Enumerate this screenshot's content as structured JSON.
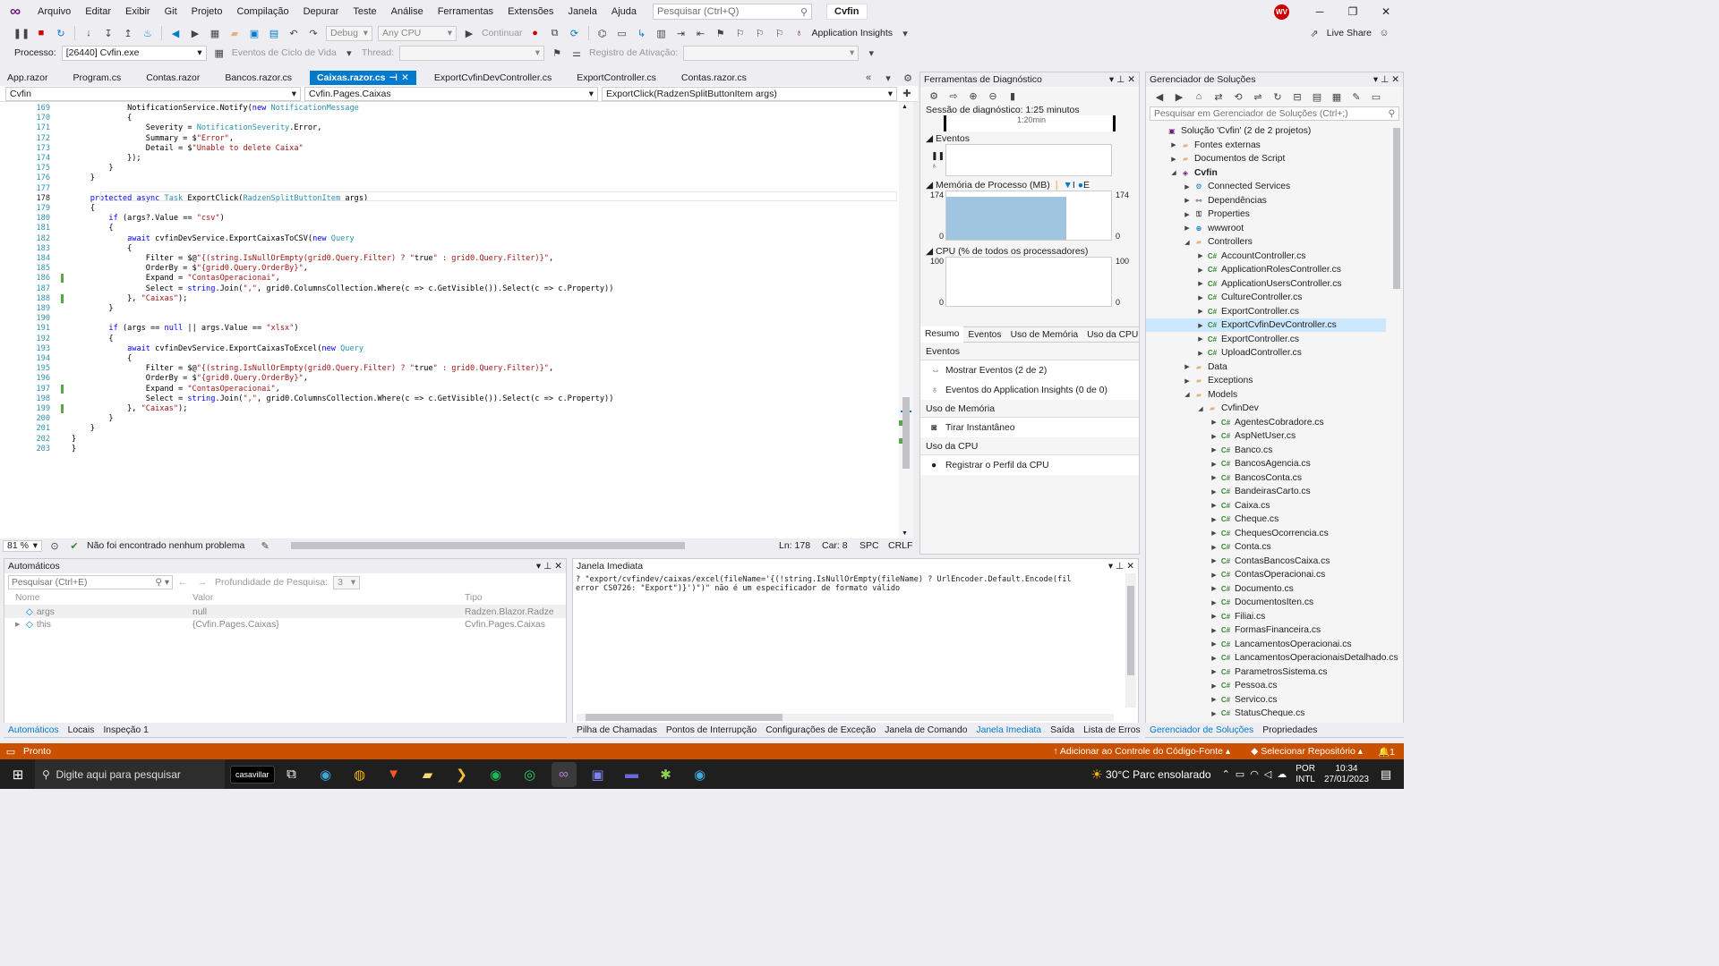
{
  "menubar": {
    "items": [
      "Arquivo",
      "Editar",
      "Exibir",
      "Git",
      "Projeto",
      "Compilação",
      "Depurar",
      "Teste",
      "Análise",
      "Ferramentas",
      "Extensões",
      "Janela",
      "Ajuda"
    ],
    "search_placeholder": "Pesquisar (Ctrl+Q)",
    "solution_title": "Cvfin",
    "avatar_initials": "WV"
  },
  "toolbar": {
    "config": "Debug",
    "platform": "Any CPU",
    "continue_label": "Continuar",
    "app_insights": "Application Insights",
    "live_share": "Live Share",
    "process_label": "Processo:",
    "process_value": "[26440] Cvfin.exe",
    "lifecycle_label": "Eventos de Ciclo de Vida",
    "thread_label": "Thread:",
    "activation_label": "Registro de Ativação:"
  },
  "tabs": [
    {
      "label": "App.razor",
      "active": false
    },
    {
      "label": "Program.cs",
      "active": false
    },
    {
      "label": "Contas.razor",
      "active": false
    },
    {
      "label": "Bancos.razor.cs",
      "active": false
    },
    {
      "label": "Caixas.razor.cs",
      "active": true
    },
    {
      "label": "ExportCvfinDevController.cs",
      "active": false
    },
    {
      "label": "ExportController.cs",
      "active": false
    },
    {
      "label": "Contas.razor.cs",
      "active": false
    }
  ],
  "navbar": {
    "project": "Cvfin",
    "class": "Cvfin.Pages.Caixas",
    "member": "ExportClick(RadzenSplitButtonItem args)"
  },
  "editor": {
    "current_line": 178,
    "lines": [
      {
        "n": 169,
        "t": "            NotificationService.Notify(new NotificationMessage"
      },
      {
        "n": 170,
        "t": "            {"
      },
      {
        "n": 171,
        "t": "                Severity = NotificationSeverity.Error,"
      },
      {
        "n": 172,
        "t": "                Summary = $\"Error\","
      },
      {
        "n": 173,
        "t": "                Detail = $\"Unable to delete Caixa\""
      },
      {
        "n": 174,
        "t": "            });"
      },
      {
        "n": 175,
        "t": "        }"
      },
      {
        "n": 176,
        "t": "    }"
      },
      {
        "n": 177,
        "t": ""
      },
      {
        "n": 178,
        "t": "    protected async Task ExportClick(RadzenSplitButtonItem args)"
      },
      {
        "n": 179,
        "t": "    {"
      },
      {
        "n": 180,
        "t": "        if (args?.Value == \"csv\")"
      },
      {
        "n": 181,
        "t": "        {"
      },
      {
        "n": 182,
        "t": "            await cvfinDevService.ExportCaixasToCSV(new Query"
      },
      {
        "n": 183,
        "t": "            {"
      },
      {
        "n": 184,
        "t": "                Filter = $@\"{(string.IsNullOrEmpty(grid0.Query.Filter) ? \"true\" : grid0.Query.Filter)}\","
      },
      {
        "n": 185,
        "t": "                OrderBy = $\"{grid0.Query.OrderBy}\","
      },
      {
        "n": 186,
        "t": "                Expand = \"ContasOperacionai\","
      },
      {
        "n": 187,
        "t": "                Select = string.Join(\",\", grid0.ColumnsCollection.Where(c => c.GetVisible()).Select(c => c.Property))"
      },
      {
        "n": 188,
        "t": "            }, \"Caixas\");"
      },
      {
        "n": 189,
        "t": "        }"
      },
      {
        "n": 190,
        "t": ""
      },
      {
        "n": 191,
        "t": "        if (args == null || args.Value == \"xlsx\")"
      },
      {
        "n": 192,
        "t": "        {"
      },
      {
        "n": 193,
        "t": "            await cvfinDevService.ExportCaixasToExcel(new Query"
      },
      {
        "n": 194,
        "t": "            {"
      },
      {
        "n": 195,
        "t": "                Filter = $@\"{(string.IsNullOrEmpty(grid0.Query.Filter) ? \"true\" : grid0.Query.Filter)}\","
      },
      {
        "n": 196,
        "t": "                OrderBy = $\"{grid0.Query.OrderBy}\","
      },
      {
        "n": 197,
        "t": "                Expand = \"ContasOperacionai\","
      },
      {
        "n": 198,
        "t": "                Select = string.Join(\",\", grid0.ColumnsCollection.Where(c => c.GetVisible()).Select(c => c.Property))"
      },
      {
        "n": 199,
        "t": "            }, \"Caixas\");"
      },
      {
        "n": 200,
        "t": "        }"
      },
      {
        "n": 201,
        "t": "    }"
      },
      {
        "n": 202,
        "t": "}"
      },
      {
        "n": 203,
        "t": "}"
      }
    ]
  },
  "editor_status": {
    "zoom": "81 %",
    "problems": "Não foi encontrado nenhum problema",
    "line": "Ln: 178",
    "char": "Car: 8",
    "spc": "SPC",
    "eol": "CRLF"
  },
  "diagnostics": {
    "title": "Ferramentas de Diagnóstico",
    "session": "Sessão de diagnóstico: 1:25 minutos",
    "timeline_tick": "1:20min",
    "events_title": "Eventos",
    "memory_title": "Memória de Processo (MB)",
    "memory_legend": [
      "I",
      "E"
    ],
    "memory_max": "174",
    "memory_min": "0",
    "cpu_title": "CPU (% de todos os processadores)",
    "cpu_max": "100",
    "cpu_min": "0",
    "tabs": [
      "Resumo",
      "Eventos",
      "Uso de Memória",
      "Uso da CPU"
    ],
    "sections": [
      {
        "title": "Eventos",
        "items": [
          "Mostrar Eventos (2 de 2)",
          "Eventos do Application Insights (0 de 0)"
        ]
      },
      {
        "title": "Uso de Memória",
        "items": [
          "Tirar Instantâneo"
        ]
      },
      {
        "title": "Uso da CPU",
        "items": [
          "Registrar o Perfil da CPU"
        ]
      }
    ]
  },
  "solution_explorer": {
    "title": "Gerenciador de Soluções",
    "search_placeholder": "Pesquisar em Gerenciador de Soluções (Ctrl+;)",
    "nodes": [
      {
        "label": "Solução 'Cvfin' (2 de 2 projetos)",
        "depth": 0,
        "icon": "sln",
        "arrow": ""
      },
      {
        "label": "Fontes externas",
        "depth": 1,
        "icon": "fold",
        "arrow": "▶"
      },
      {
        "label": "Documentos de Script",
        "depth": 1,
        "icon": "fold",
        "arrow": "▶"
      },
      {
        "label": "Cvfin",
        "depth": 1,
        "icon": "proj",
        "arrow": "◢",
        "bold": true
      },
      {
        "label": "Connected Services",
        "depth": 2,
        "icon": "svc",
        "arrow": "▶"
      },
      {
        "label": "Dependências",
        "depth": 2,
        "icon": "dep",
        "arrow": "▶"
      },
      {
        "label": "Properties",
        "depth": 2,
        "icon": "prop",
        "arrow": "▶"
      },
      {
        "label": "wwwroot",
        "depth": 2,
        "icon": "globe",
        "arrow": "▶"
      },
      {
        "label": "Controllers",
        "depth": 2,
        "icon": "fold",
        "arrow": "◢"
      },
      {
        "label": "AccountController.cs",
        "depth": 3,
        "icon": "cs",
        "arrow": "▶"
      },
      {
        "label": "ApplicationRolesController.cs",
        "depth": 3,
        "icon": "cs",
        "arrow": "▶"
      },
      {
        "label": "ApplicationUsersController.cs",
        "depth": 3,
        "icon": "cs",
        "arrow": "▶"
      },
      {
        "label": "CultureController.cs",
        "depth": 3,
        "icon": "cs",
        "arrow": "▶"
      },
      {
        "label": "ExportController.cs",
        "depth": 3,
        "icon": "cs",
        "arrow": "▶"
      },
      {
        "label": "ExportCvfinDevController.cs",
        "depth": 3,
        "icon": "cs",
        "arrow": "▶",
        "selected": true
      },
      {
        "label": "ExportController.cs",
        "depth": 3,
        "icon": "cs",
        "arrow": "▶"
      },
      {
        "label": "UploadController.cs",
        "depth": 3,
        "icon": "cs",
        "arrow": "▶"
      },
      {
        "label": "Data",
        "depth": 2,
        "icon": "fold",
        "arrow": "▶"
      },
      {
        "label": "Exceptions",
        "depth": 2,
        "icon": "fold",
        "arrow": "▶"
      },
      {
        "label": "Models",
        "depth": 2,
        "icon": "fold",
        "arrow": "◢"
      },
      {
        "label": "CvfinDev",
        "depth": 3,
        "icon": "fold",
        "arrow": "◢"
      },
      {
        "label": "AgentesCobradore.cs",
        "depth": 4,
        "icon": "cs",
        "arrow": "▶"
      },
      {
        "label": "AspNetUser.cs",
        "depth": 4,
        "icon": "cs",
        "arrow": "▶"
      },
      {
        "label": "Banco.cs",
        "depth": 4,
        "icon": "cs",
        "arrow": "▶"
      },
      {
        "label": "BancosAgencia.cs",
        "depth": 4,
        "icon": "cs",
        "arrow": "▶"
      },
      {
        "label": "BancosConta.cs",
        "depth": 4,
        "icon": "cs",
        "arrow": "▶"
      },
      {
        "label": "BandeirasCarto.cs",
        "depth": 4,
        "icon": "cs",
        "arrow": "▶"
      },
      {
        "label": "Caixa.cs",
        "depth": 4,
        "icon": "cs",
        "arrow": "▶"
      },
      {
        "label": "Cheque.cs",
        "depth": 4,
        "icon": "cs",
        "arrow": "▶"
      },
      {
        "label": "ChequesOcorrencia.cs",
        "depth": 4,
        "icon": "cs",
        "arrow": "▶"
      },
      {
        "label": "Conta.cs",
        "depth": 4,
        "icon": "cs",
        "arrow": "▶"
      },
      {
        "label": "ContasBancosCaixa.cs",
        "depth": 4,
        "icon": "cs",
        "arrow": "▶"
      },
      {
        "label": "ContasOperacionai.cs",
        "depth": 4,
        "icon": "cs",
        "arrow": "▶"
      },
      {
        "label": "Documento.cs",
        "depth": 4,
        "icon": "cs",
        "arrow": "▶"
      },
      {
        "label": "DocumentosIten.cs",
        "depth": 4,
        "icon": "cs",
        "arrow": "▶"
      },
      {
        "label": "Filiai.cs",
        "depth": 4,
        "icon": "cs",
        "arrow": "▶"
      },
      {
        "label": "FormasFinanceira.cs",
        "depth": 4,
        "icon": "cs",
        "arrow": "▶"
      },
      {
        "label": "LancamentosOperacionai.cs",
        "depth": 4,
        "icon": "cs",
        "arrow": "▶"
      },
      {
        "label": "LancamentosOperacionaisDetalhado.cs",
        "depth": 4,
        "icon": "cs",
        "arrow": "▶"
      },
      {
        "label": "ParametrosSistema.cs",
        "depth": 4,
        "icon": "cs",
        "arrow": "▶"
      },
      {
        "label": "Pessoa.cs",
        "depth": 4,
        "icon": "cs",
        "arrow": "▶"
      },
      {
        "label": "Servico.cs",
        "depth": 4,
        "icon": "cs",
        "arrow": "▶"
      },
      {
        "label": "StatusCheque.cs",
        "depth": 4,
        "icon": "cs",
        "arrow": "▶"
      }
    ],
    "bottom_tabs": [
      "Gerenciador de Soluções",
      "Propriedades"
    ]
  },
  "autos": {
    "title": "Automáticos",
    "search_placeholder": "Pesquisar (Ctrl+E)",
    "depth_label": "Profundidade de Pesquisa:",
    "depth_value": "3",
    "columns": [
      "Nome",
      "Valor",
      "Tipo"
    ],
    "rows": [
      {
        "name": "args",
        "value": "null",
        "type": "Radzen.Blazor.Radze..."
      },
      {
        "name": "this",
        "value": "{Cvfin.Pages.Caixas}",
        "type": "Cvfin.Pages.Caixas"
      }
    ],
    "tabs": [
      "Automáticos",
      "Locais",
      "Inspeção 1"
    ]
  },
  "immediate": {
    "title": "Janela Imediata",
    "lines": [
      "? \"export/cvfindev/caixas/excel(fileName='{(!string.IsNullOrEmpty(fileName) ? UrlEncoder.Default.Encode(fil",
      "error CS0726: \"Export\")}')\")\" não é um especificador de formato válido"
    ],
    "tabs": [
      "Pilha de Chamadas",
      "Pontos de Interrupção",
      "Configurações de Exceção",
      "Janela de Comando",
      "Janela Imediata",
      "Saída",
      "Lista de Erros"
    ]
  },
  "statusbar": {
    "ready": "Pronto",
    "source_control": "Adicionar ao Controle do Código-Fonte",
    "repo": "Selecionar Repositório",
    "notif": "1"
  },
  "taskbar": {
    "search_placeholder": "Digite aqui para pesquisar",
    "pinned_label": "casavillar",
    "weather": "30°C  Parc ensolarado",
    "lang1": "POR",
    "lang2": "INTL",
    "time": "10:34",
    "date": "27/01/2023"
  },
  "colors": {
    "accent": "#007acc",
    "statusbar": "#ca5100",
    "vs_purple": "#68217a",
    "memory_fill": "#9fc5e0"
  }
}
